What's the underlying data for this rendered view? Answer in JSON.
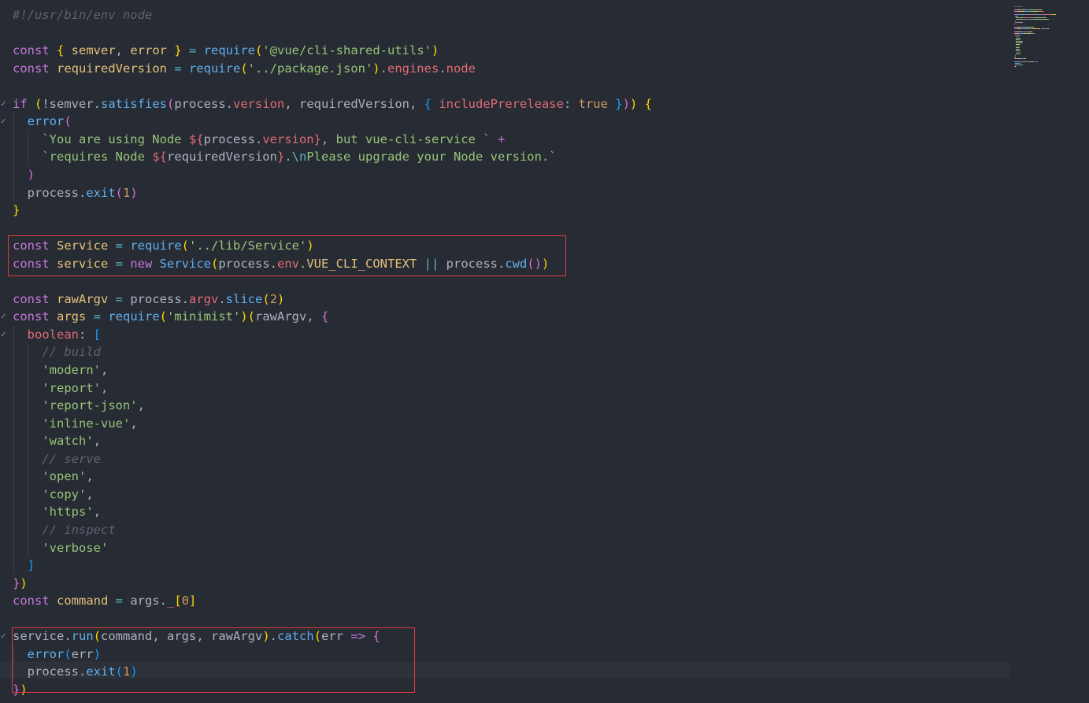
{
  "editor": {
    "language": "javascript",
    "colors": {
      "background": "#272b33",
      "keyword": "#c678dd",
      "variable": "#e5c07b",
      "function": "#61afef",
      "string": "#98c379",
      "property": "#e06c75",
      "comment": "#5c6370",
      "highlight_box": "#e13c3c"
    },
    "lines": [
      {
        "fold": "",
        "tokens": [
          {
            "t": "#!/usr/bin/env node",
            "k": "comment"
          }
        ]
      },
      {
        "fold": "",
        "tokens": []
      },
      {
        "fold": "",
        "tokens": [
          {
            "t": "const ",
            "k": "keyword"
          },
          {
            "t": "{ ",
            "k": "bracket-gold"
          },
          {
            "t": "semver",
            "k": "variable"
          },
          {
            "t": ", ",
            "k": "plain"
          },
          {
            "t": "error",
            "k": "variable"
          },
          {
            "t": " }",
            "k": "bracket-gold"
          },
          {
            "t": " = ",
            "k": "operator"
          },
          {
            "t": "require",
            "k": "function"
          },
          {
            "t": "(",
            "k": "bracket-gold"
          },
          {
            "t": "'@vue/cli-shared-utils'",
            "k": "string"
          },
          {
            "t": ")",
            "k": "bracket-gold"
          }
        ]
      },
      {
        "fold": "",
        "tokens": [
          {
            "t": "const ",
            "k": "keyword"
          },
          {
            "t": "requiredVersion",
            "k": "variable"
          },
          {
            "t": " = ",
            "k": "operator"
          },
          {
            "t": "require",
            "k": "function"
          },
          {
            "t": "(",
            "k": "bracket-gold"
          },
          {
            "t": "'../package.json'",
            "k": "string"
          },
          {
            "t": ")",
            "k": "bracket-gold"
          },
          {
            "t": ".",
            "k": "plain"
          },
          {
            "t": "engines",
            "k": "property"
          },
          {
            "t": ".",
            "k": "plain"
          },
          {
            "t": "node",
            "k": "property"
          }
        ]
      },
      {
        "fold": "",
        "tokens": []
      },
      {
        "fold": "✓",
        "tokens": [
          {
            "t": "if ",
            "k": "keyword"
          },
          {
            "t": "(",
            "k": "bracket-gold"
          },
          {
            "t": "!semver.",
            "k": "plain"
          },
          {
            "t": "satisfies",
            "k": "function"
          },
          {
            "t": "(",
            "k": "bracket-pink"
          },
          {
            "t": "process",
            "k": "plain"
          },
          {
            "t": ".",
            "k": "plain"
          },
          {
            "t": "version",
            "k": "property"
          },
          {
            "t": ", requiredVersion, ",
            "k": "plain"
          },
          {
            "t": "{ ",
            "k": "bracket-blue"
          },
          {
            "t": "includePrerelease",
            "k": "property"
          },
          {
            "t": ": ",
            "k": "plain"
          },
          {
            "t": "true",
            "k": "number"
          },
          {
            "t": " }",
            "k": "bracket-blue"
          },
          {
            "t": ")",
            "k": "bracket-pink"
          },
          {
            "t": ") ",
            "k": "bracket-gold"
          },
          {
            "t": "{",
            "k": "bracket-gold"
          }
        ]
      },
      {
        "fold": "✓",
        "tokens": [
          {
            "t": "  error",
            "k": "function"
          },
          {
            "t": "(",
            "k": "bracket-pink"
          }
        ]
      },
      {
        "fold": "",
        "tokens": [
          {
            "t": "    `You are using Node ",
            "k": "string"
          },
          {
            "t": "${",
            "k": "template"
          },
          {
            "t": "process",
            "k": "plain"
          },
          {
            "t": ".",
            "k": "plain"
          },
          {
            "t": "version",
            "k": "property"
          },
          {
            "t": "}",
            "k": "template"
          },
          {
            "t": ", but vue-cli-service ` ",
            "k": "string"
          },
          {
            "t": "+",
            "k": "keyword"
          }
        ]
      },
      {
        "fold": "",
        "tokens": [
          {
            "t": "    `requires Node ",
            "k": "string"
          },
          {
            "t": "${",
            "k": "template"
          },
          {
            "t": "requiredVersion",
            "k": "plain"
          },
          {
            "t": "}",
            "k": "template"
          },
          {
            "t": ".",
            "k": "string"
          },
          {
            "t": "\\n",
            "k": "escape"
          },
          {
            "t": "Please upgrade your Node version.`",
            "k": "string"
          }
        ]
      },
      {
        "fold": "",
        "tokens": [
          {
            "t": "  )",
            "k": "bracket-pink"
          }
        ]
      },
      {
        "fold": "",
        "tokens": [
          {
            "t": "  process.",
            "k": "plain"
          },
          {
            "t": "exit",
            "k": "function"
          },
          {
            "t": "(",
            "k": "bracket-pink"
          },
          {
            "t": "1",
            "k": "number"
          },
          {
            "t": ")",
            "k": "bracket-pink"
          }
        ]
      },
      {
        "fold": "",
        "tokens": [
          {
            "t": "}",
            "k": "bracket-gold"
          }
        ]
      },
      {
        "fold": "",
        "tokens": []
      },
      {
        "fold": "",
        "tokens": [
          {
            "t": "const ",
            "k": "keyword"
          },
          {
            "t": "Service",
            "k": "variable"
          },
          {
            "t": " = ",
            "k": "operator"
          },
          {
            "t": "require",
            "k": "function"
          },
          {
            "t": "(",
            "k": "bracket-gold"
          },
          {
            "t": "'../lib/Service'",
            "k": "string"
          },
          {
            "t": ")",
            "k": "bracket-gold"
          }
        ]
      },
      {
        "fold": "",
        "tokens": [
          {
            "t": "const ",
            "k": "keyword"
          },
          {
            "t": "service",
            "k": "variable"
          },
          {
            "t": " = ",
            "k": "operator"
          },
          {
            "t": "new ",
            "k": "keyword"
          },
          {
            "t": "Service",
            "k": "function"
          },
          {
            "t": "(",
            "k": "bracket-gold"
          },
          {
            "t": "process",
            "k": "plain"
          },
          {
            "t": ".",
            "k": "plain"
          },
          {
            "t": "env",
            "k": "property"
          },
          {
            "t": ".",
            "k": "plain"
          },
          {
            "t": "VUE_CLI_CONTEXT",
            "k": "variable"
          },
          {
            "t": " || ",
            "k": "operator"
          },
          {
            "t": "process",
            "k": "plain"
          },
          {
            "t": ".",
            "k": "plain"
          },
          {
            "t": "cwd",
            "k": "function"
          },
          {
            "t": "()",
            "k": "bracket-pink"
          },
          {
            "t": ")",
            "k": "bracket-gold"
          }
        ]
      },
      {
        "fold": "",
        "tokens": []
      },
      {
        "fold": "",
        "tokens": [
          {
            "t": "const ",
            "k": "keyword"
          },
          {
            "t": "rawArgv",
            "k": "variable"
          },
          {
            "t": " = ",
            "k": "operator"
          },
          {
            "t": "process",
            "k": "plain"
          },
          {
            "t": ".",
            "k": "plain"
          },
          {
            "t": "argv",
            "k": "property"
          },
          {
            "t": ".",
            "k": "plain"
          },
          {
            "t": "slice",
            "k": "function"
          },
          {
            "t": "(",
            "k": "bracket-gold"
          },
          {
            "t": "2",
            "k": "number"
          },
          {
            "t": ")",
            "k": "bracket-gold"
          }
        ]
      },
      {
        "fold": "✓",
        "tokens": [
          {
            "t": "const ",
            "k": "keyword"
          },
          {
            "t": "args",
            "k": "variable"
          },
          {
            "t": " = ",
            "k": "operator"
          },
          {
            "t": "require",
            "k": "function"
          },
          {
            "t": "(",
            "k": "bracket-gold"
          },
          {
            "t": "'minimist'",
            "k": "string"
          },
          {
            "t": ")",
            "k": "bracket-gold"
          },
          {
            "t": "(",
            "k": "bracket-gold"
          },
          {
            "t": "rawArgv, ",
            "k": "plain"
          },
          {
            "t": "{",
            "k": "bracket-pink"
          }
        ]
      },
      {
        "fold": "✓",
        "tokens": [
          {
            "t": "  boolean",
            "k": "property"
          },
          {
            "t": ": ",
            "k": "plain"
          },
          {
            "t": "[",
            "k": "bracket-blue"
          }
        ]
      },
      {
        "fold": "",
        "tokens": [
          {
            "t": "    // build",
            "k": "comment"
          }
        ]
      },
      {
        "fold": "",
        "tokens": [
          {
            "t": "    'modern'",
            "k": "string"
          },
          {
            "t": ",",
            "k": "plain"
          }
        ]
      },
      {
        "fold": "",
        "tokens": [
          {
            "t": "    'report'",
            "k": "string"
          },
          {
            "t": ",",
            "k": "plain"
          }
        ]
      },
      {
        "fold": "",
        "tokens": [
          {
            "t": "    'report-json'",
            "k": "string"
          },
          {
            "t": ",",
            "k": "plain"
          }
        ]
      },
      {
        "fold": "",
        "tokens": [
          {
            "t": "    'inline-vue'",
            "k": "string"
          },
          {
            "t": ",",
            "k": "plain"
          }
        ]
      },
      {
        "fold": "",
        "tokens": [
          {
            "t": "    'watch'",
            "k": "string"
          },
          {
            "t": ",",
            "k": "plain"
          }
        ]
      },
      {
        "fold": "",
        "tokens": [
          {
            "t": "    // serve",
            "k": "comment"
          }
        ]
      },
      {
        "fold": "",
        "tokens": [
          {
            "t": "    'open'",
            "k": "string"
          },
          {
            "t": ",",
            "k": "plain"
          }
        ]
      },
      {
        "fold": "",
        "tokens": [
          {
            "t": "    'copy'",
            "k": "string"
          },
          {
            "t": ",",
            "k": "plain"
          }
        ]
      },
      {
        "fold": "",
        "tokens": [
          {
            "t": "    'https'",
            "k": "string"
          },
          {
            "t": ",",
            "k": "plain"
          }
        ]
      },
      {
        "fold": "",
        "tokens": [
          {
            "t": "    // inspect",
            "k": "comment"
          }
        ]
      },
      {
        "fold": "",
        "tokens": [
          {
            "t": "    'verbose'",
            "k": "string"
          }
        ]
      },
      {
        "fold": "",
        "tokens": [
          {
            "t": "  ]",
            "k": "bracket-blue"
          }
        ]
      },
      {
        "fold": "",
        "tokens": [
          {
            "t": "}",
            "k": "bracket-pink"
          },
          {
            "t": ")",
            "k": "bracket-gold"
          }
        ]
      },
      {
        "fold": "",
        "tokens": [
          {
            "t": "const ",
            "k": "keyword"
          },
          {
            "t": "command",
            "k": "variable"
          },
          {
            "t": " = ",
            "k": "operator"
          },
          {
            "t": "args.",
            "k": "plain"
          },
          {
            "t": "_",
            "k": "property"
          },
          {
            "t": "[",
            "k": "bracket-gold"
          },
          {
            "t": "0",
            "k": "number"
          },
          {
            "t": "]",
            "k": "bracket-gold"
          }
        ]
      },
      {
        "fold": "",
        "tokens": []
      },
      {
        "fold": "✓",
        "tokens": [
          {
            "t": "service",
            "k": "plain"
          },
          {
            "t": ".",
            "k": "plain"
          },
          {
            "t": "run",
            "k": "function"
          },
          {
            "t": "(",
            "k": "bracket-gold"
          },
          {
            "t": "command, args, rawArgv",
            "k": "plain"
          },
          {
            "t": ")",
            "k": "bracket-gold"
          },
          {
            "t": ".",
            "k": "plain"
          },
          {
            "t": "catch",
            "k": "function"
          },
          {
            "t": "(",
            "k": "bracket-gold"
          },
          {
            "t": "err",
            "k": "plain"
          },
          {
            "t": " => ",
            "k": "keyword"
          },
          {
            "t": "{",
            "k": "bracket-pink"
          }
        ]
      },
      {
        "fold": "",
        "tokens": [
          {
            "t": "  error",
            "k": "function"
          },
          {
            "t": "(",
            "k": "bracket-blue"
          },
          {
            "t": "err",
            "k": "plain"
          },
          {
            "t": ")",
            "k": "bracket-blue"
          }
        ]
      },
      {
        "fold": "",
        "tokens": [
          {
            "t": "  process.",
            "k": "plain"
          },
          {
            "t": "exit",
            "k": "function"
          },
          {
            "t": "(",
            "k": "bracket-blue"
          },
          {
            "t": "1",
            "k": "number"
          },
          {
            "t": ")",
            "k": "bracket-blue"
          }
        ]
      },
      {
        "fold": "",
        "tokens": [
          {
            "t": "}",
            "k": "bracket-pink"
          },
          {
            "t": ")",
            "k": "bracket-gold"
          }
        ]
      }
    ]
  }
}
